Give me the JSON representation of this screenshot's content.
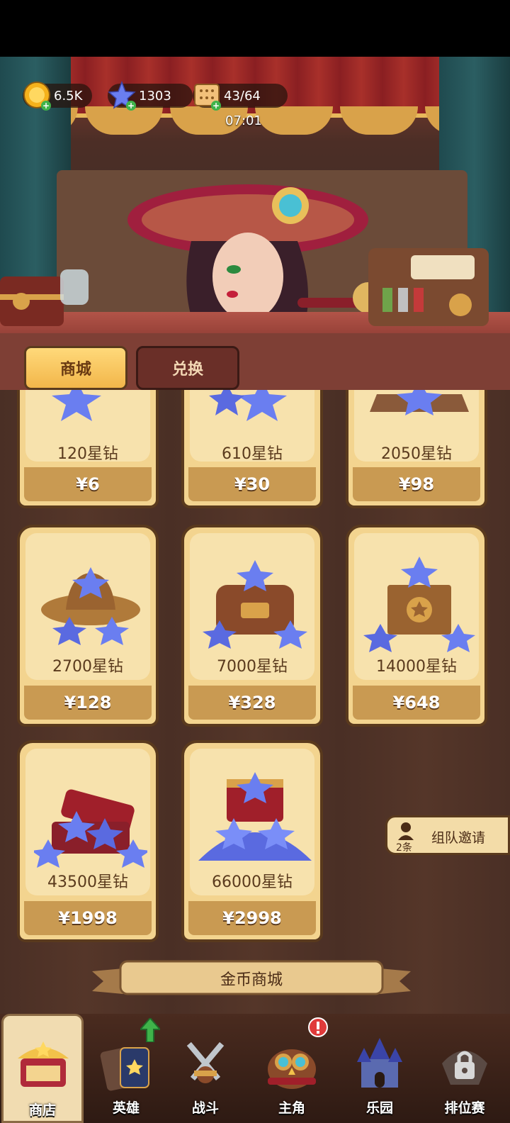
{
  "hud": {
    "coins": "6.5K",
    "gems": "1303",
    "stamina": "43/64",
    "timer": "07:01"
  },
  "tabs": [
    {
      "label": "商城",
      "active": true
    },
    {
      "label": "兑换",
      "active": false
    }
  ],
  "products": [
    {
      "amount": "120星钻",
      "price": "¥6"
    },
    {
      "amount": "610星钻",
      "price": "¥30"
    },
    {
      "amount": "2050星钻",
      "price": "¥98"
    },
    {
      "amount": "2700星钻",
      "price": "¥128"
    },
    {
      "amount": "7000星钻",
      "price": "¥328"
    },
    {
      "amount": "14000星钻",
      "price": "¥648"
    },
    {
      "amount": "43500星钻",
      "price": "¥1998"
    },
    {
      "amount": "66000星钻",
      "price": "¥2998"
    }
  ],
  "gold_shop_banner": "金币商城",
  "invite": {
    "count": "2条",
    "label": "组队邀请"
  },
  "nav": [
    {
      "label": "商店",
      "icon": "shop-stall-icon",
      "active": true
    },
    {
      "label": "英雄",
      "icon": "hero-cards-icon",
      "badge": "upgrade-arrow"
    },
    {
      "label": "战斗",
      "icon": "crossed-swords-icon"
    },
    {
      "label": "主角",
      "icon": "owl-goggles-icon",
      "badge": "alert"
    },
    {
      "label": "乐园",
      "icon": "castle-icon"
    },
    {
      "label": "排位赛",
      "icon": "lock-icon",
      "locked": true
    }
  ],
  "colors": {
    "accent": "#f2b64a",
    "panel": "#f3d48f",
    "price_bar": "#c99a52"
  }
}
